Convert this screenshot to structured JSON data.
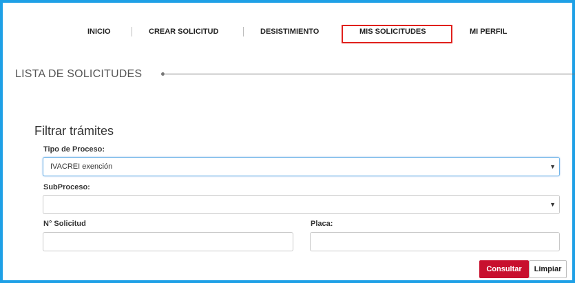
{
  "nav": {
    "items": [
      {
        "label": "INICIO"
      },
      {
        "label": "CREAR SOLICITUD"
      },
      {
        "label": "DESISTIMIENTO"
      },
      {
        "label": "MIS SOLICITUDES"
      },
      {
        "label": "MI PERFIL"
      }
    ],
    "highlight_color": "#e0201c"
  },
  "section": {
    "title": "LISTA DE SOLICITUDES"
  },
  "filter": {
    "title": "Filtrar trámites",
    "tipo_proceso": {
      "label": "Tipo de Proceso:",
      "value": "IVACREI exención"
    },
    "subproceso": {
      "label": "SubProceso:",
      "value": ""
    },
    "solicitud": {
      "label": "N° Solicitud",
      "value": ""
    },
    "placa": {
      "label": "Placa:",
      "value": ""
    },
    "buttons": {
      "consultar": "Consultar",
      "limpiar": "Limpiar"
    }
  },
  "icons": {
    "dropdown": "chevron-down-icon"
  },
  "colors": {
    "frame": "#1ea0e6",
    "primary_button": "#c8102e"
  }
}
